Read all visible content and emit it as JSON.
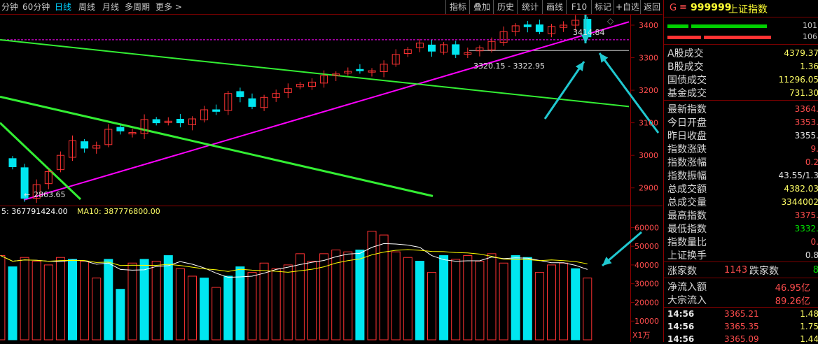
{
  "periods": [
    {
      "label": "分钟",
      "active": false
    },
    {
      "label": "60分钟",
      "active": false
    },
    {
      "label": "日线",
      "active": true
    },
    {
      "label": "周线",
      "active": false
    },
    {
      "label": "月线",
      "active": false
    },
    {
      "label": "多周期",
      "active": false
    },
    {
      "label": "更多 >",
      "active": false
    }
  ],
  "toolbar": [
    "指标",
    "叠加",
    "历史",
    "统计",
    "画线",
    "F10",
    "标记",
    "+自选",
    "返回"
  ],
  "chart": {
    "price_axis": [
      "3400",
      "3300",
      "3200",
      "3100",
      "3000",
      "2900"
    ],
    "volume_axis": [
      "60000",
      "50000",
      "40000",
      "30000",
      "20000",
      "10000"
    ],
    "volume_unit": "X1万",
    "annot_high": "3414.84",
    "annot_range": "3320.15 - 3322.95",
    "annot_low": "2863.65",
    "ma_legend_ma5": "5: 367791424.00",
    "ma_legend_ma10": "MA10: 387776800.00",
    "colors": {
      "up": "#ff3232",
      "down": "#00e6f0",
      "ma5": "#ffffff",
      "ma10": "#ffff00",
      "trend_pink": "#ff00ff",
      "trend_green": "#33ee33",
      "arrow": "#20c8d0"
    }
  },
  "chart_data": {
    "type": "candlestick",
    "ohlc_close": [
      2965,
      2868,
      2910,
      2950,
      3000,
      3045,
      3022,
      3030,
      3080,
      3075,
      3070,
      3110,
      3100,
      3105,
      3100,
      3112,
      3140,
      3135,
      3190,
      3180,
      3150,
      3178,
      3190,
      3205,
      3218,
      3225,
      3245,
      3250,
      3258,
      3262,
      3260,
      3280,
      3310,
      3325,
      3345,
      3320,
      3340,
      3310,
      3315,
      3330,
      3350,
      3380,
      3398,
      3395,
      3380,
      3396,
      3400,
      3415,
      3364
    ],
    "volume": [
      45000,
      39000,
      44000,
      42000,
      40000,
      44000,
      43000,
      42000,
      33000,
      43000,
      27000,
      41000,
      43000,
      42000,
      45000,
      38000,
      34000,
      33000,
      28000,
      34000,
      39000,
      36000,
      41000,
      38000,
      40000,
      46000,
      42000,
      46000,
      48000,
      47000,
      48000,
      58000,
      56000,
      47000,
      44000,
      42000,
      36000,
      45000,
      43000,
      45000,
      42000,
      46000,
      41000,
      45000,
      44000,
      36000,
      40000,
      41000,
      38000,
      33000
    ],
    "price_ylim": [
      2850,
      3430
    ],
    "volume_ylim": [
      0,
      65000
    ]
  },
  "panel": {
    "code": "999999",
    "name": "上证指数",
    "g": "G",
    "eq": "≡",
    "bar1_val": "101",
    "bar2_val": "106",
    "rows_a": [
      {
        "label": "A股成交",
        "value": "4379.37",
        "color": "#ffff66"
      },
      {
        "label": "B股成交",
        "value": "1.36",
        "color": "#ffff66"
      },
      {
        "label": "国债成交",
        "value": "11296.05",
        "color": "#ffff66"
      },
      {
        "label": "基金成交",
        "value": "731.30",
        "color": "#ffff66"
      }
    ],
    "rows_b": [
      {
        "label": "最新指数",
        "value": "3364.",
        "color": "#ff4d4d"
      },
      {
        "label": "今日开盘",
        "value": "3353.",
        "color": "#ff4d4d"
      },
      {
        "label": "昨日收盘",
        "value": "3355.",
        "color": "#e0e0e0"
      },
      {
        "label": "指数涨跌",
        "value": "9.",
        "color": "#ff4d4d"
      },
      {
        "label": "指数涨幅",
        "value": "0.2",
        "color": "#ff4d4d"
      },
      {
        "label": "指数振幅",
        "value": "43.55/1.3",
        "color": "#e0e0e0"
      },
      {
        "label": "总成交额",
        "value": "4382.03",
        "color": "#ffff66"
      },
      {
        "label": "总成交量",
        "value": "3344002",
        "color": "#ffff66"
      },
      {
        "label": "最高指数",
        "value": "3375.",
        "color": "#ff4d4d"
      },
      {
        "label": "最低指数",
        "value": "3332.",
        "color": "#00e000"
      },
      {
        "label": "指数量比",
        "value": "0.",
        "color": "#ff4d4d"
      },
      {
        "label": "上证换手",
        "value": "0.8",
        "color": "#e0e0e0"
      }
    ],
    "up_label": "涨家数",
    "up_count": "1143",
    "down_label": "跌家数",
    "down_count": "8",
    "flow_label": "净流入额",
    "flow_val": "46.95亿",
    "block_label": "大宗流入",
    "block_val": "89.26亿",
    "ticks": [
      {
        "time": "14:56",
        "price": "3365.21",
        "vol": "1.48"
      },
      {
        "time": "14:56",
        "price": "3365.35",
        "vol": "1.75"
      },
      {
        "time": "14:56",
        "price": "3365.09",
        "vol": "1.44"
      }
    ]
  }
}
